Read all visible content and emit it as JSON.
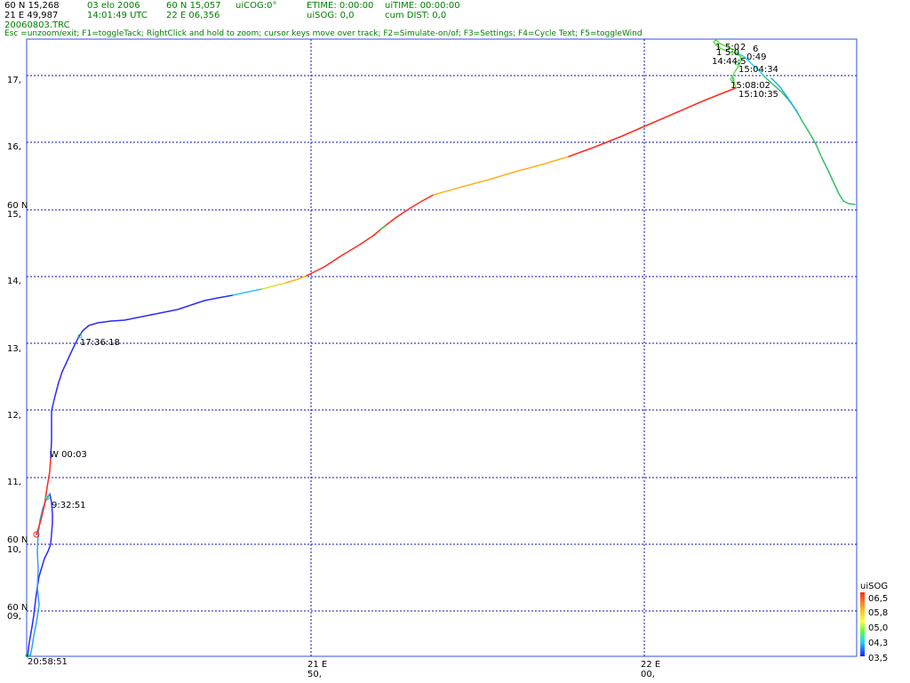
{
  "header": {
    "lat": "60 N 15,268",
    "lon": "21 E 49,987",
    "date": "03 elo 2006",
    "time_utc": "14:01:49 UTC",
    "lat2": "60 N 15,057",
    "lon2": "22 E 06,356",
    "cog": "uiCOG:0°",
    "etime": "ETIME: 0:00:00",
    "sog": "uiSOG: 0,0",
    "uitime": "uiTIME: 00:00:00",
    "cumdist": "cum DIST: 0,0",
    "filename": "20060803.TRC",
    "help": "Esc =unzoom/exit; F1=toggleTack; RightClick and hold to zoom; cursor keys move over track; F2=Simulate-on/of; F3=Settings; F4=Cycle Text; F5=toggleWind"
  },
  "colors": {
    "frame": "#3050e0",
    "grid": "#1010c0",
    "header_green": "#008000",
    "speed_scale": [
      "#ff2a1a",
      "#ffb020",
      "#ffff40",
      "#60ff40",
      "#20d0ff",
      "#2020ff"
    ]
  },
  "map": {
    "y_axis": [
      {
        "value": 17,
        "label": "17,"
      },
      {
        "value": 16,
        "label": "16,"
      },
      {
        "value": 15,
        "label": "15,",
        "prefix": "60 N"
      },
      {
        "value": 14,
        "label": "14,"
      },
      {
        "value": 13,
        "label": "13,"
      },
      {
        "value": 12,
        "label": "12,"
      },
      {
        "value": 11,
        "label": "11,"
      },
      {
        "value": 10,
        "label": "10,",
        "prefix": "60 N"
      },
      {
        "value": 9,
        "label": "09,",
        "prefix": "60 N"
      }
    ],
    "x_axis": [
      {
        "value": 50,
        "top": "21 E",
        "bottom": "50,"
      },
      {
        "value": 60,
        "top": "22 E",
        "bottom": "00,"
      }
    ],
    "legend": {
      "title": "uiSOG",
      "ticks": [
        "06,5",
        "05,8",
        "05,0",
        "04,3",
        "03,5"
      ]
    },
    "track_labels": [
      {
        "text": "17:36:18"
      },
      {
        "text": "W 00:03"
      },
      {
        "text": "9:32:51"
      },
      {
        "text": "20:58:51"
      },
      {
        "text": "15:08:02"
      },
      {
        "text": "15:10:35"
      },
      {
        "text": "15:04:34"
      },
      {
        "text": "14:44:5"
      },
      {
        "text": "1"
      },
      {
        "text": "5:0"
      },
      {
        "text": "0:49"
      },
      {
        "text": "1"
      },
      {
        "text": "5:0"
      },
      {
        "text": "2"
      },
      {
        "text": "6"
      }
    ]
  }
}
